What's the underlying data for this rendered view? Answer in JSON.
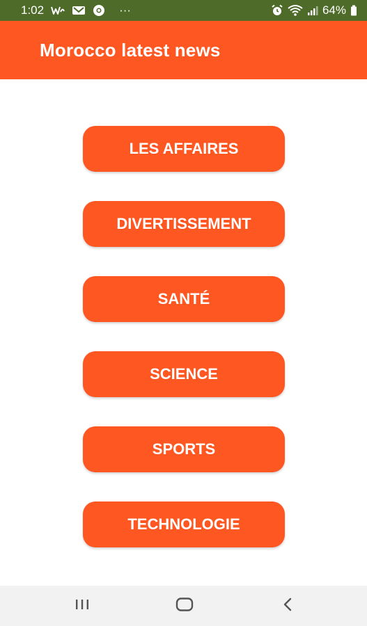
{
  "status_bar": {
    "time": "1:02",
    "more_dots": "···",
    "battery_percent": "64%",
    "background_color": "#4e6b2a"
  },
  "app_bar": {
    "title": "Morocco latest news",
    "background_color": "#ff5722"
  },
  "categories": [
    {
      "label": "LES AFFAIRES"
    },
    {
      "label": "DIVERTISSEMENT"
    },
    {
      "label": "SANTÉ"
    },
    {
      "label": "SCIENCE"
    },
    {
      "label": "SPORTS"
    },
    {
      "label": "TECHNOLOGIE"
    }
  ],
  "accent_color": "#ff5722",
  "nav_bar": {
    "recents_icon": "recents-icon",
    "home_icon": "home-icon",
    "back_icon": "back-icon"
  }
}
